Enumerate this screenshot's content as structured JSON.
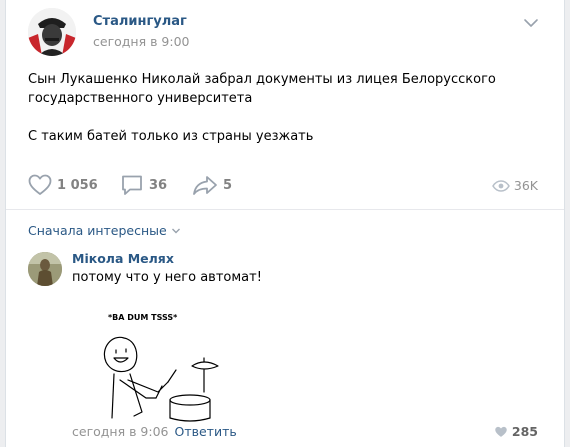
{
  "post": {
    "author": "Сталингулаг",
    "time": "сегодня в 9:00",
    "text_line1": "Сын Лукашенко Николай забрал документы из лицея Белорусского",
    "text_line2": "государственного университета",
    "text_line3": "С таким батей только из страны уезжать"
  },
  "actions": {
    "likes": "1 056",
    "comments": "36",
    "shares": "5",
    "views": "36K"
  },
  "comments_sort": "Сначала интересные",
  "comment": {
    "author": "Мікола Мелях",
    "text": "потому что у него автомат!",
    "image_caption": "*BA DUM TSSS*",
    "time": "сегодня в 9:06",
    "reply_label": "Ответить",
    "likes": "285"
  },
  "colors": {
    "link": "#2a5885",
    "muted": "#939393",
    "icon": "#99a2ad"
  }
}
